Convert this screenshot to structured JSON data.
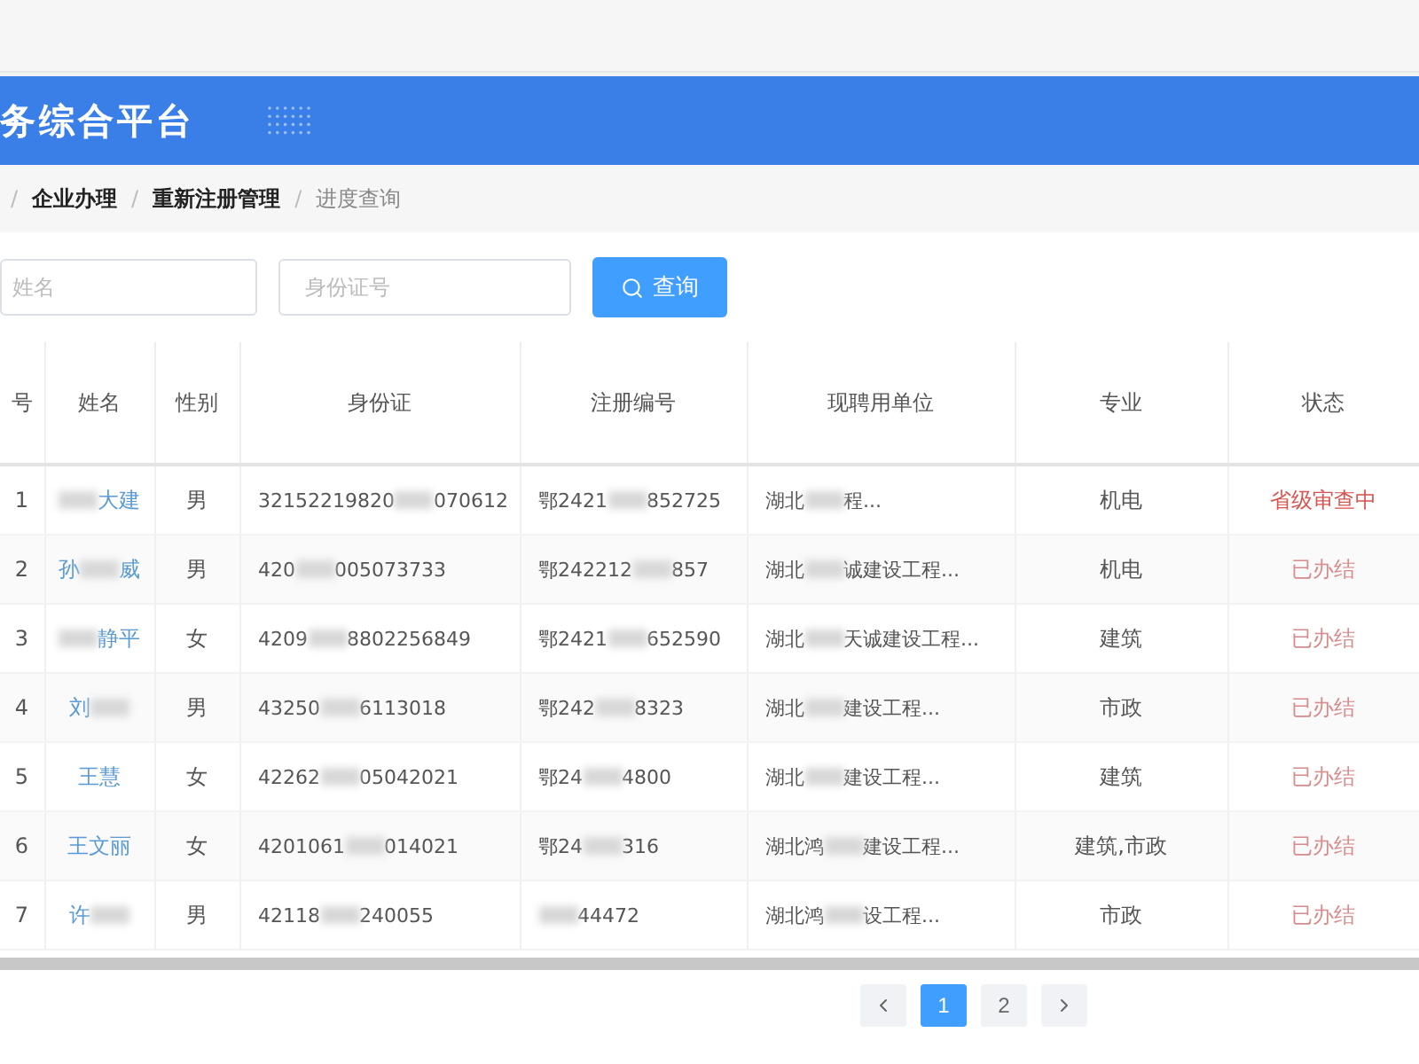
{
  "header": {
    "title": "务综合平台"
  },
  "breadcrumb": {
    "separator": "/",
    "items": [
      {
        "label": "企业办理",
        "current": false
      },
      {
        "label": "重新注册管理",
        "current": false
      },
      {
        "label": "进度查询",
        "current": true
      }
    ]
  },
  "search": {
    "fields": [
      {
        "placeholder": "姓名"
      },
      {
        "placeholder": "身份证号"
      }
    ],
    "button": "查询"
  },
  "table": {
    "columns": [
      "号",
      "姓名",
      "性别",
      "身份证",
      "注册编号",
      "现聘用单位",
      "专业",
      "状态"
    ],
    "rows": [
      {
        "no": "1",
        "name": [
          {
            "kind": "blur"
          },
          {
            "kind": "text",
            "text": "大建"
          }
        ],
        "gender": "男",
        "id": [
          {
            "kind": "text",
            "text": "32152219820"
          },
          {
            "kind": "blur"
          },
          {
            "kind": "text",
            "text": "070612"
          }
        ],
        "reg": [
          {
            "kind": "text",
            "text": "鄂2421"
          },
          {
            "kind": "blur"
          },
          {
            "kind": "text",
            "text": "852725"
          }
        ],
        "unit": [
          {
            "kind": "text",
            "text": "湖北"
          },
          {
            "kind": "blur"
          },
          {
            "kind": "text",
            "text": "程..."
          }
        ],
        "major": "机电",
        "status": "省级审查中",
        "color": "#d9534f"
      },
      {
        "no": "2",
        "name": [
          {
            "kind": "text",
            "text": "孙"
          },
          {
            "kind": "blur"
          },
          {
            "kind": "text",
            "text": "威"
          }
        ],
        "gender": "男",
        "id": [
          {
            "kind": "text",
            "text": "420"
          },
          {
            "kind": "blur"
          },
          {
            "kind": "text",
            "text": "005073733"
          }
        ],
        "reg": [
          {
            "kind": "text",
            "text": "鄂242212"
          },
          {
            "kind": "blur"
          },
          {
            "kind": "text",
            "text": "857"
          }
        ],
        "unit": [
          {
            "kind": "text",
            "text": "湖北"
          },
          {
            "kind": "blur"
          },
          {
            "kind": "text",
            "text": "诚建设工程..."
          }
        ],
        "major": "机电",
        "status": "已办结",
        "color": "#d98a8a"
      },
      {
        "no": "3",
        "name": [
          {
            "kind": "blur"
          },
          {
            "kind": "text",
            "text": "静平"
          }
        ],
        "gender": "女",
        "id": [
          {
            "kind": "text",
            "text": "4209"
          },
          {
            "kind": "blur"
          },
          {
            "kind": "text",
            "text": "8802256849"
          }
        ],
        "reg": [
          {
            "kind": "text",
            "text": "鄂2421"
          },
          {
            "kind": "blur"
          },
          {
            "kind": "text",
            "text": "652590"
          }
        ],
        "unit": [
          {
            "kind": "text",
            "text": "湖北"
          },
          {
            "kind": "blur"
          },
          {
            "kind": "text",
            "text": "天诚建设工程..."
          }
        ],
        "major": "建筑",
        "status": "已办结",
        "color": "#d98a8a"
      },
      {
        "no": "4",
        "name": [
          {
            "kind": "text",
            "text": "刘"
          },
          {
            "kind": "blur"
          }
        ],
        "gender": "男",
        "id": [
          {
            "kind": "text",
            "text": "43250"
          },
          {
            "kind": "blur"
          },
          {
            "kind": "text",
            "text": "6113018"
          }
        ],
        "reg": [
          {
            "kind": "text",
            "text": "鄂242"
          },
          {
            "kind": "blur"
          },
          {
            "kind": "text",
            "text": "8323"
          }
        ],
        "unit": [
          {
            "kind": "text",
            "text": "湖北"
          },
          {
            "kind": "blur"
          },
          {
            "kind": "text",
            "text": "建设工程..."
          }
        ],
        "major": "市政",
        "status": "已办结",
        "color": "#d98a8a"
      },
      {
        "no": "5",
        "name": [
          {
            "kind": "text",
            "text": "王慧"
          }
        ],
        "gender": "女",
        "id": [
          {
            "kind": "text",
            "text": "42262"
          },
          {
            "kind": "blur"
          },
          {
            "kind": "text",
            "text": "05042021"
          }
        ],
        "reg": [
          {
            "kind": "text",
            "text": "鄂24"
          },
          {
            "kind": "blur"
          },
          {
            "kind": "text",
            "text": "4800"
          }
        ],
        "unit": [
          {
            "kind": "text",
            "text": "湖北"
          },
          {
            "kind": "blur"
          },
          {
            "kind": "text",
            "text": "建设工程..."
          }
        ],
        "major": "建筑",
        "status": "已办结",
        "color": "#d98a8a"
      },
      {
        "no": "6",
        "name": [
          {
            "kind": "text",
            "text": "王文丽"
          }
        ],
        "gender": "女",
        "id": [
          {
            "kind": "text",
            "text": "4201061"
          },
          {
            "kind": "blur"
          },
          {
            "kind": "text",
            "text": "014021"
          }
        ],
        "reg": [
          {
            "kind": "text",
            "text": "鄂24"
          },
          {
            "kind": "blur"
          },
          {
            "kind": "text",
            "text": "316"
          }
        ],
        "unit": [
          {
            "kind": "text",
            "text": "湖北鸿"
          },
          {
            "kind": "blur"
          },
          {
            "kind": "text",
            "text": "建设工程..."
          }
        ],
        "major": "建筑,市政",
        "status": "已办结",
        "color": "#d98a8a"
      },
      {
        "no": "7",
        "name": [
          {
            "kind": "text",
            "text": "许"
          },
          {
            "kind": "blur"
          }
        ],
        "gender": "男",
        "id": [
          {
            "kind": "text",
            "text": "42118"
          },
          {
            "kind": "blur"
          },
          {
            "kind": "text",
            "text": "240055"
          }
        ],
        "reg": [
          {
            "kind": "blur"
          },
          {
            "kind": "text",
            "text": "44472"
          }
        ],
        "unit": [
          {
            "kind": "text",
            "text": "湖北鸿"
          },
          {
            "kind": "blur"
          },
          {
            "kind": "text",
            "text": "设工程..."
          }
        ],
        "major": "市政",
        "status": "已办结",
        "color": "#d98a8a"
      }
    ]
  },
  "pagination": {
    "pages": [
      {
        "label": "1",
        "selected": true
      },
      {
        "label": "2",
        "selected": false
      }
    ]
  }
}
